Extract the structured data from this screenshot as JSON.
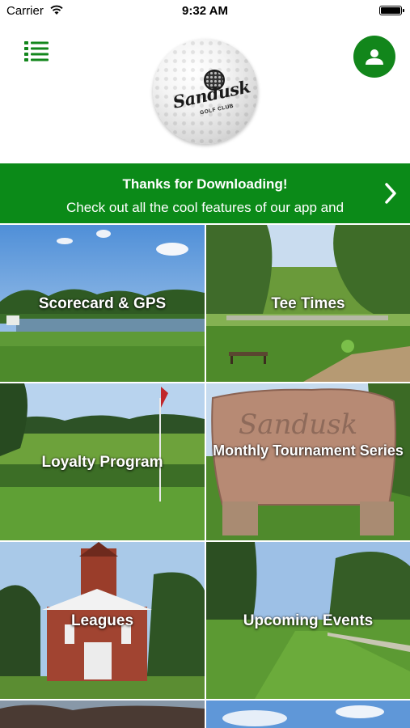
{
  "status_bar": {
    "carrier": "Carrier",
    "time": "9:32 AM"
  },
  "header": {
    "menu_icon": "list-icon",
    "profile_icon": "user-icon",
    "accent": "#12861b"
  },
  "logo": {
    "brand": "Sandusk",
    "sub": "GOLF CLUB"
  },
  "banner": {
    "title": "Thanks for Downloading!",
    "message": "Check out all the cool features of our app and",
    "background": "#0b8a18",
    "chevron_icon": "chevron-right-icon"
  },
  "tiles": [
    {
      "label": "Scorecard & GPS"
    },
    {
      "label": "Tee Times"
    },
    {
      "label": "Loyalty Program"
    },
    {
      "label": "Monthly Tournament Series"
    },
    {
      "label": "Leagues"
    },
    {
      "label": "Upcoming Events"
    }
  ]
}
